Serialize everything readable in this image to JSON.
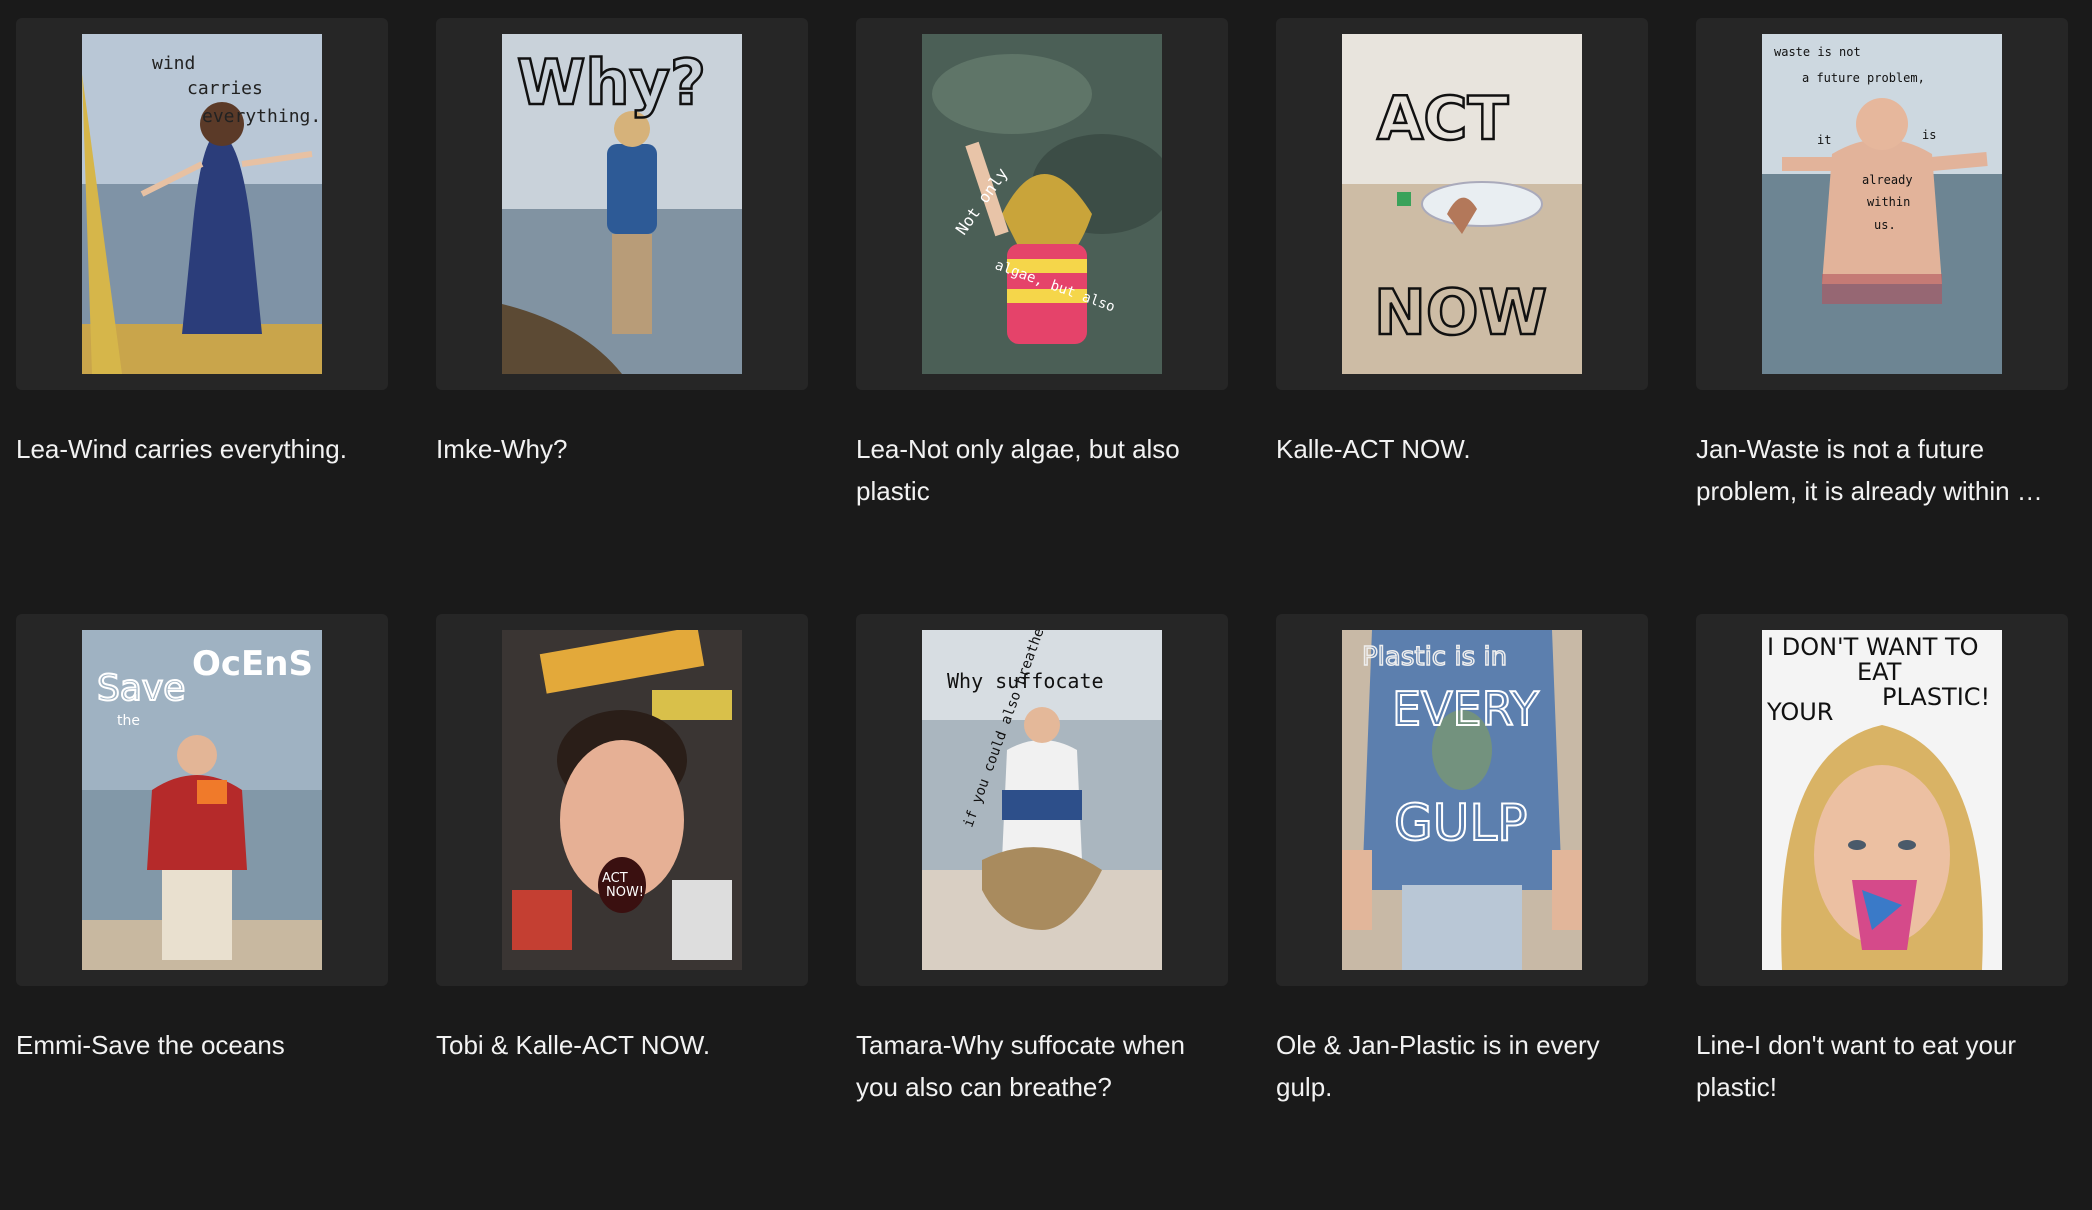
{
  "cards": [
    {
      "title": "Lea-Wind carries everything.",
      "poster_text": [
        "wind",
        "carries",
        "everything."
      ],
      "icon": "poster-image"
    },
    {
      "title": "Imke-Why?",
      "poster_text": [
        "Why?"
      ],
      "icon": "poster-image"
    },
    {
      "title": "Lea-Not only algae, but also plastic",
      "poster_text": [
        "Not only",
        "algae, but also"
      ],
      "icon": "poster-image"
    },
    {
      "title": "Kalle-ACT NOW.",
      "poster_text": [
        "ACT",
        "NOW"
      ],
      "icon": "poster-image"
    },
    {
      "title": "Jan-Waste is not a future problem, it is already within …",
      "poster_text": [
        "waste is not",
        "a future problem,",
        "it",
        "is",
        "already",
        "within",
        "us."
      ],
      "icon": "poster-image"
    },
    {
      "title": "Emmi-Save the oceans",
      "poster_text": [
        "Save",
        "the",
        "OcEnS"
      ],
      "icon": "poster-image"
    },
    {
      "title": "Tobi & Kalle-ACT NOW.",
      "poster_text": [
        "ACT",
        "NOW!"
      ],
      "icon": "poster-image"
    },
    {
      "title": "Tamara-Why suffocate when you also can breathe?",
      "poster_text": [
        "Why suffocate",
        "if you could also breathe?"
      ],
      "icon": "poster-image"
    },
    {
      "title": "Ole & Jan-Plastic is in every gulp.",
      "poster_text": [
        "Plastic is in",
        "EVERY",
        "GULP"
      ],
      "icon": "poster-image"
    },
    {
      "title": "Line-I don't want to eat your plastic!",
      "poster_text": [
        "I DON'T WANT TO",
        "EAT",
        "YOUR",
        "PLASTIC!"
      ],
      "icon": "poster-image"
    }
  ]
}
